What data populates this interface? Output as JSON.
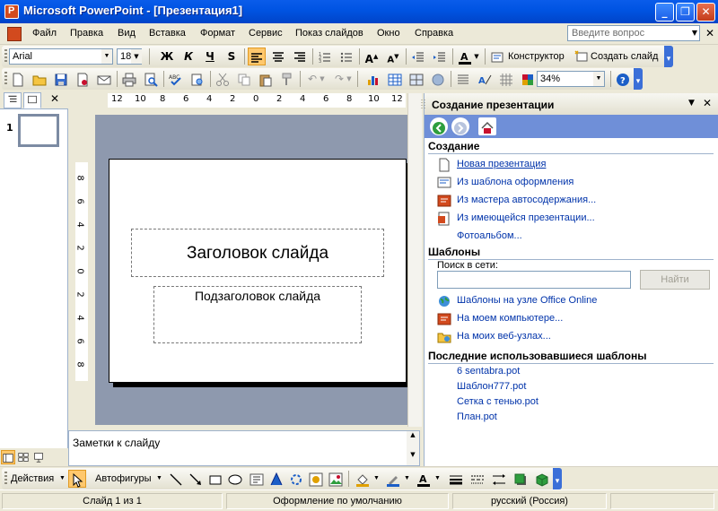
{
  "window": {
    "title": "Microsoft PowerPoint - [Презентация1]",
    "minimize": "_",
    "restore": "❐",
    "close": "✕"
  },
  "menu": {
    "items": [
      "Файл",
      "Правка",
      "Вид",
      "Вставка",
      "Формат",
      "Сервис",
      "Показ слайдов",
      "Окно",
      "Справка"
    ],
    "help_placeholder": "Введите вопрос"
  },
  "formatting": {
    "font": "Arial",
    "size": "18",
    "bold": "Ж",
    "italic": "К",
    "underline": "Ч",
    "shadow": "S",
    "designer": "Конструктор",
    "new_slide": "Создать слайд"
  },
  "standard": {
    "zoom": "34%"
  },
  "rulers": {
    "horizontal": [
      "12",
      "10",
      "8",
      "6",
      "4",
      "2",
      "0",
      "2",
      "4",
      "6",
      "8",
      "10",
      "12"
    ],
    "vertical": [
      "8",
      "6",
      "4",
      "2",
      "0",
      "2",
      "4",
      "6",
      "8"
    ]
  },
  "thumbnails": {
    "slide_number": "1"
  },
  "slide": {
    "title_placeholder": "Заголовок слайда",
    "subtitle_placeholder": "Подзаголовок слайда"
  },
  "notes": {
    "placeholder": "Заметки к слайду"
  },
  "taskpane": {
    "title": "Создание презентации",
    "sections": {
      "create": "Создание",
      "templates": "Шаблоны",
      "recent": "Последние использовавшиеся шаблоны"
    },
    "create_links": [
      "Новая презентация",
      "Из шаблона оформления",
      "Из мастера автосодержания...",
      "Из имеющейся презентации...",
      "Фотоальбом..."
    ],
    "search_label": "Поиск в сети:",
    "search_button": "Найти",
    "template_links": [
      "Шаблоны на узле Office Online",
      "На моем компьютере...",
      "На моих веб-узлах..."
    ],
    "recent_templates": [
      "6 sentabra.pot",
      "Шаблон777.pot",
      "Сетка с тенью.pot",
      "План.pot"
    ]
  },
  "drawing": {
    "actions": "Действия",
    "autoshapes": "Автофигуры"
  },
  "status": {
    "slide": "Слайд 1 из 1",
    "design": "Оформление по умолчанию",
    "language": "русский (Россия)"
  },
  "colors": {
    "titlebar": "#0054E3",
    "taskpane_nav": "#6F8FD8",
    "link": "#0033AA",
    "workarea": "#8E99AE"
  }
}
